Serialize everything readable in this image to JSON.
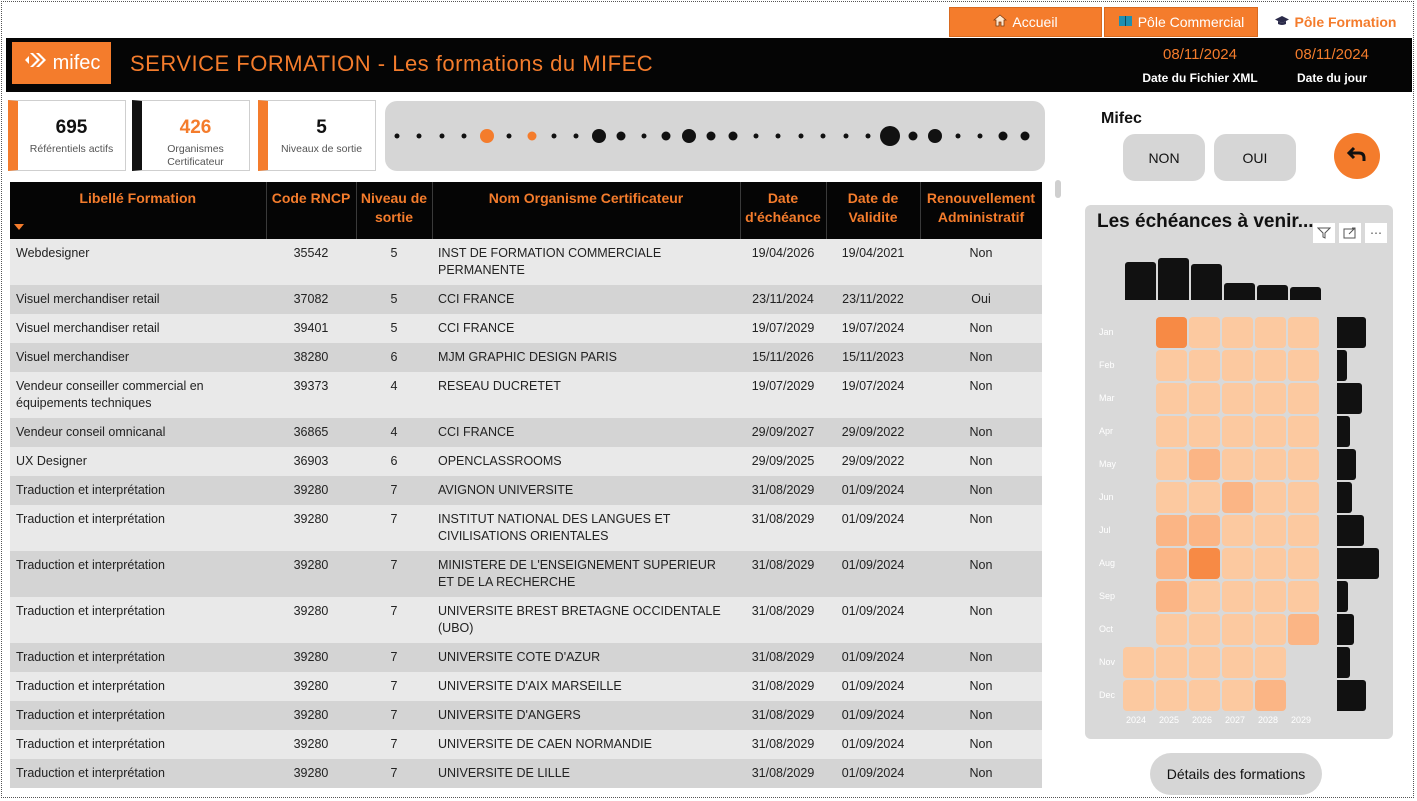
{
  "nav": {
    "home_label": "Accueil",
    "commercial_label": "Pôle Commercial",
    "formation_label": "Pôle Formation"
  },
  "header": {
    "logo_text": "mifec",
    "title": "SERVICE FORMATION - Les formations du MIFEC",
    "date_xml_value": "08/11/2024",
    "date_xml_label": "Date du Fichier XML",
    "date_day_value": "08/11/2024",
    "date_day_label": "Date du jour"
  },
  "kpis": [
    {
      "value": "695",
      "label": "Référentiels actifs"
    },
    {
      "value": "426",
      "label": "Organismes Certificateur"
    },
    {
      "value": "5",
      "label": "Niveaux de sortie"
    }
  ],
  "timeline_dots": [
    {
      "size": "s",
      "orange": false
    },
    {
      "size": "s",
      "orange": false
    },
    {
      "size": "s",
      "orange": false
    },
    {
      "size": "s",
      "orange": false
    },
    {
      "size": "l",
      "orange": true
    },
    {
      "size": "s",
      "orange": false
    },
    {
      "size": "m",
      "orange": true
    },
    {
      "size": "s",
      "orange": false
    },
    {
      "size": "s",
      "orange": false
    },
    {
      "size": "l",
      "orange": false
    },
    {
      "size": "m",
      "orange": false
    },
    {
      "size": "s",
      "orange": false
    },
    {
      "size": "m",
      "orange": false
    },
    {
      "size": "l",
      "orange": false
    },
    {
      "size": "m",
      "orange": false
    },
    {
      "size": "m",
      "orange": false
    },
    {
      "size": "s",
      "orange": false
    },
    {
      "size": "s",
      "orange": false
    },
    {
      "size": "s",
      "orange": false
    },
    {
      "size": "s",
      "orange": false
    },
    {
      "size": "s",
      "orange": false
    },
    {
      "size": "s",
      "orange": false
    },
    {
      "size": "xl",
      "orange": false
    },
    {
      "size": "m",
      "orange": false
    },
    {
      "size": "l",
      "orange": false
    },
    {
      "size": "s",
      "orange": false
    },
    {
      "size": "s",
      "orange": false
    },
    {
      "size": "m",
      "orange": false
    },
    {
      "size": "m",
      "orange": false
    }
  ],
  "table": {
    "headers": [
      "Libellé Formation",
      "Code RNCP",
      "Niveau de sortie",
      "Nom Organisme Certificateur",
      "Date d'échéance",
      "Date de Validite",
      "Renouvellement Administratif"
    ],
    "rows": [
      [
        "Webdesigner",
        "35542",
        "5",
        "INST DE FORMATION COMMERCIALE PERMANENTE",
        "19/04/2026",
        "19/04/2021",
        "Non"
      ],
      [
        "Visuel merchandiser retail",
        "37082",
        "5",
        "CCI FRANCE",
        "23/11/2024",
        "23/11/2022",
        "Oui"
      ],
      [
        "Visuel merchandiser retail",
        "39401",
        "5",
        "CCI FRANCE",
        "19/07/2029",
        "19/07/2024",
        "Non"
      ],
      [
        "Visuel merchandiser",
        "38280",
        "6",
        "MJM GRAPHIC DESIGN PARIS",
        "15/11/2026",
        "15/11/2023",
        "Non"
      ],
      [
        "Vendeur conseiller commercial en équipements techniques",
        "39373",
        "4",
        "RESEAU DUCRETET",
        "19/07/2029",
        "19/07/2024",
        "Non"
      ],
      [
        "Vendeur conseil omnicanal",
        "36865",
        "4",
        "CCI FRANCE",
        "29/09/2027",
        "29/09/2022",
        "Non"
      ],
      [
        "UX Designer",
        "36903",
        "6",
        "OPENCLASSROOMS",
        "29/09/2025",
        "29/09/2022",
        "Non"
      ],
      [
        "Traduction et interprétation",
        "39280",
        "7",
        "AVIGNON UNIVERSITE",
        "31/08/2029",
        "01/09/2024",
        "Non"
      ],
      [
        "Traduction et interprétation",
        "39280",
        "7",
        "INSTITUT NATIONAL DES LANGUES ET CIVILISATIONS ORIENTALES",
        "31/08/2029",
        "01/09/2024",
        "Non"
      ],
      [
        "Traduction et interprétation",
        "39280",
        "7",
        "MINISTERE DE L'ENSEIGNEMENT SUPERIEUR ET DE LA RECHERCHE",
        "31/08/2029",
        "01/09/2024",
        "Non"
      ],
      [
        "Traduction et interprétation",
        "39280",
        "7",
        "UNIVERSITE BREST BRETAGNE OCCIDENTALE (UBO)",
        "31/08/2029",
        "01/09/2024",
        "Non"
      ],
      [
        "Traduction et interprétation",
        "39280",
        "7",
        "UNIVERSITE COTE D'AZUR",
        "31/08/2029",
        "01/09/2024",
        "Non"
      ],
      [
        "Traduction et interprétation",
        "39280",
        "7",
        "UNIVERSITE D'AIX MARSEILLE",
        "31/08/2029",
        "01/09/2024",
        "Non"
      ],
      [
        "Traduction et interprétation",
        "39280",
        "7",
        "UNIVERSITE D'ANGERS",
        "31/08/2029",
        "01/09/2024",
        "Non"
      ],
      [
        "Traduction et interprétation",
        "39280",
        "7",
        "UNIVERSITE DE CAEN NORMANDIE",
        "31/08/2029",
        "01/09/2024",
        "Non"
      ],
      [
        "Traduction et interprétation",
        "39280",
        "7",
        "UNIVERSITE DE LILLE",
        "31/08/2029",
        "01/09/2024",
        "Non"
      ]
    ]
  },
  "filter": {
    "label": "Mifec",
    "no_label": "NON",
    "yes_label": "OUI"
  },
  "heatmap": {
    "title": "Les échéances à venir...",
    "years": [
      "2024",
      "2025",
      "2026",
      "2027",
      "2028",
      "2029"
    ],
    "months": [
      "Jan",
      "Feb",
      "Mar",
      "Apr",
      "May",
      "Jun",
      "Jul",
      "Aug",
      "Sep",
      "Oct",
      "Nov",
      "Dec"
    ],
    "intensity": [
      [
        null,
        3,
        1,
        1,
        1,
        1
      ],
      [
        null,
        1,
        1,
        1,
        1,
        1
      ],
      [
        null,
        1,
        1,
        1,
        1,
        1
      ],
      [
        null,
        1,
        1,
        1,
        1,
        1
      ],
      [
        null,
        1,
        2,
        1,
        1,
        1
      ],
      [
        null,
        1,
        1,
        2,
        1,
        1
      ],
      [
        null,
        2,
        2,
        1,
        1,
        1
      ],
      [
        null,
        2,
        3,
        1,
        1,
        1
      ],
      [
        null,
        2,
        1,
        1,
        1,
        1
      ],
      [
        null,
        1,
        1,
        1,
        1,
        2
      ],
      [
        1,
        1,
        1,
        1,
        1,
        null
      ],
      [
        1,
        1,
        1,
        1,
        2,
        null
      ]
    ],
    "year_totals": [
      40,
      44,
      38,
      18,
      16,
      14
    ],
    "month_totals": [
      30,
      10,
      26,
      14,
      20,
      16,
      28,
      44,
      12,
      18,
      14,
      30
    ]
  },
  "details_label": "Détails des formations"
}
